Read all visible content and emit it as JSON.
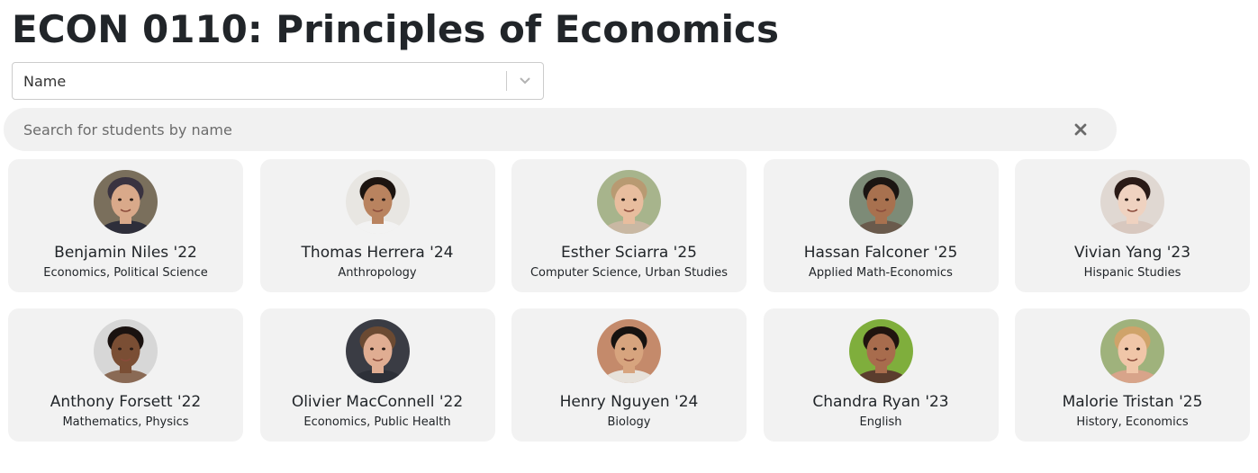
{
  "course": {
    "title": "ECON 0110: Principles of Economics"
  },
  "sort": {
    "selected": "Name"
  },
  "search": {
    "placeholder": "Search for students by name",
    "value": ""
  },
  "students": [
    {
      "name": "Benjamin Niles '22",
      "majors": "Economics, Political Science",
      "skin": "#d9a98a",
      "hair": "#3a3340",
      "bg": "#7a6f5c",
      "shirt": "#2e2e3a"
    },
    {
      "name": "Thomas Herrera '24",
      "majors": "Anthropology",
      "skin": "#b9835f",
      "hair": "#1c1410",
      "bg": "#e8e6e2",
      "shirt": "#f2f2f2"
    },
    {
      "name": "Esther Sciarra '25",
      "majors": "Computer Science, Urban Studies",
      "skin": "#e8bd9e",
      "hair": "#b89a72",
      "bg": "#a7b48c",
      "shirt": "#c9b8a3"
    },
    {
      "name": "Hassan Falconer '25",
      "majors": "Applied Math-Economics",
      "skin": "#a8714f",
      "hair": "#1b1512",
      "bg": "#7d8b77",
      "shirt": "#6a5a4c"
    },
    {
      "name": "Vivian Yang '23",
      "majors": "Hispanic Studies",
      "skin": "#efd2c0",
      "hair": "#2a1a16",
      "bg": "#e0d8d2",
      "shirt": "#d8c8bf"
    },
    {
      "name": "Anthony Forsett '22",
      "majors": "Mathematics, Physics",
      "skin": "#7a4e34",
      "hair": "#1a1210",
      "bg": "#d7d7d7",
      "shirt": "#8a6a55"
    },
    {
      "name": "Olivier MacConnell '22",
      "majors": "Economics, Public Health",
      "skin": "#e0ad92",
      "hair": "#6b4a32",
      "bg": "#3a3c44",
      "shirt": "#2d3038"
    },
    {
      "name": "Henry Nguyen '24",
      "majors": "Biology",
      "skin": "#d7a47e",
      "hair": "#161210",
      "bg": "#c48a6b",
      "shirt": "#e7e2db"
    },
    {
      "name": "Chandra Ryan '23",
      "majors": "English",
      "skin": "#a86c4d",
      "hair": "#20140f",
      "bg": "#7fae3c",
      "shirt": "#5b3d2e"
    },
    {
      "name": "Malorie Tristan '25",
      "majors": "History, Economics",
      "skin": "#f0c6a8",
      "hair": "#cfa36a",
      "bg": "#9fb27c",
      "shirt": "#d8a48a"
    }
  ]
}
